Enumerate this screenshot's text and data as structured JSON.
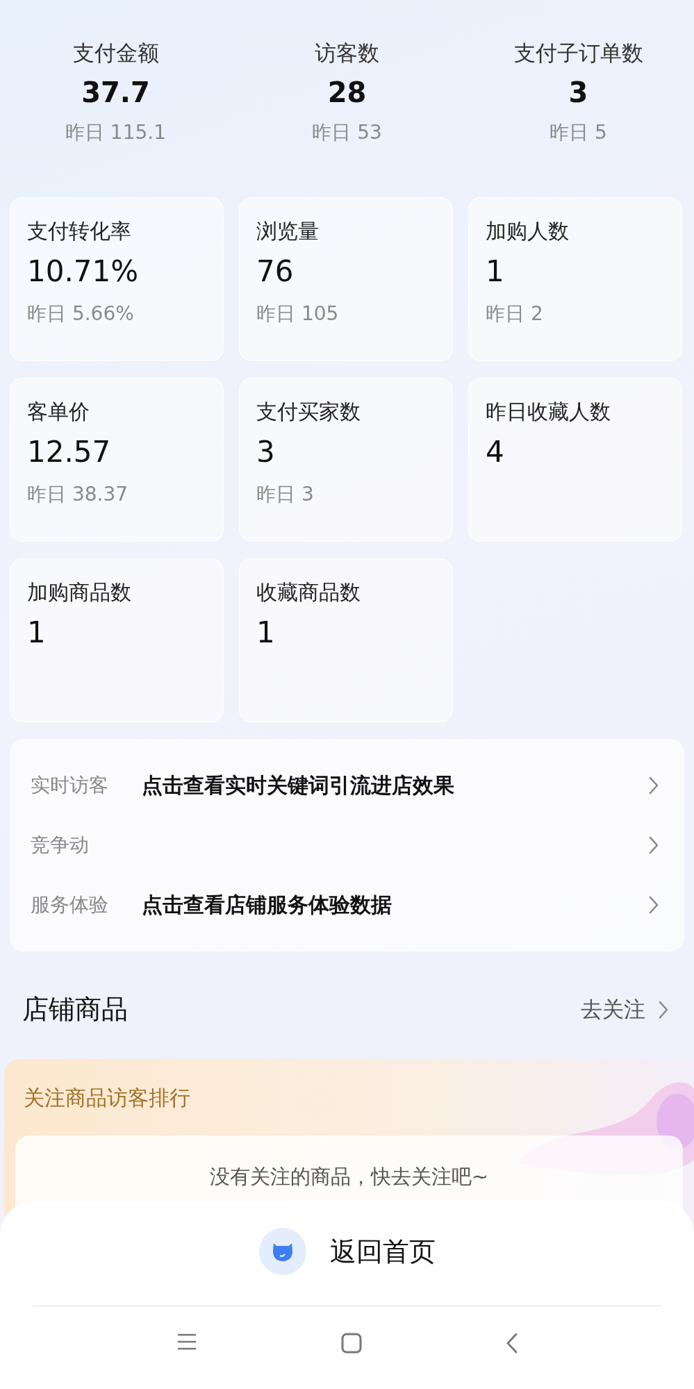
{
  "summary": [
    {
      "label": "支付金额",
      "value": "37.7",
      "yesterday": "昨日 115.1"
    },
    {
      "label": "访客数",
      "value": "28",
      "yesterday": "昨日 53"
    },
    {
      "label": "支付子订单数",
      "value": "3",
      "yesterday": "昨日 5"
    }
  ],
  "metrics": [
    {
      "label": "支付转化率",
      "value": "10.71%",
      "yesterday": "昨日 5.66%"
    },
    {
      "label": "浏览量",
      "value": "76",
      "yesterday": "昨日 105"
    },
    {
      "label": "加购人数",
      "value": "1",
      "yesterday": "昨日 2"
    },
    {
      "label": "客单价",
      "value": "12.57",
      "yesterday": "昨日 38.37"
    },
    {
      "label": "支付买家数",
      "value": "3",
      "yesterday": "昨日 3"
    },
    {
      "label": "昨日收藏人数",
      "value": "4"
    },
    {
      "label": "加购商品数",
      "value": "1"
    },
    {
      "label": "收藏商品数",
      "value": "1"
    }
  ],
  "links": [
    {
      "label": "实时访客",
      "text": "点击查看实时关键词引流进店效果"
    },
    {
      "label": "竞争动"
    },
    {
      "label": "服务体验",
      "text": "点击查看店铺服务体验数据"
    }
  ],
  "section": {
    "title": "店铺商品",
    "action": "去关注"
  },
  "focus_card": {
    "title": "关注商品访客排行",
    "empty_message": "没有关注的商品，快去关注吧~"
  },
  "home_button": {
    "label": "返回首页"
  }
}
